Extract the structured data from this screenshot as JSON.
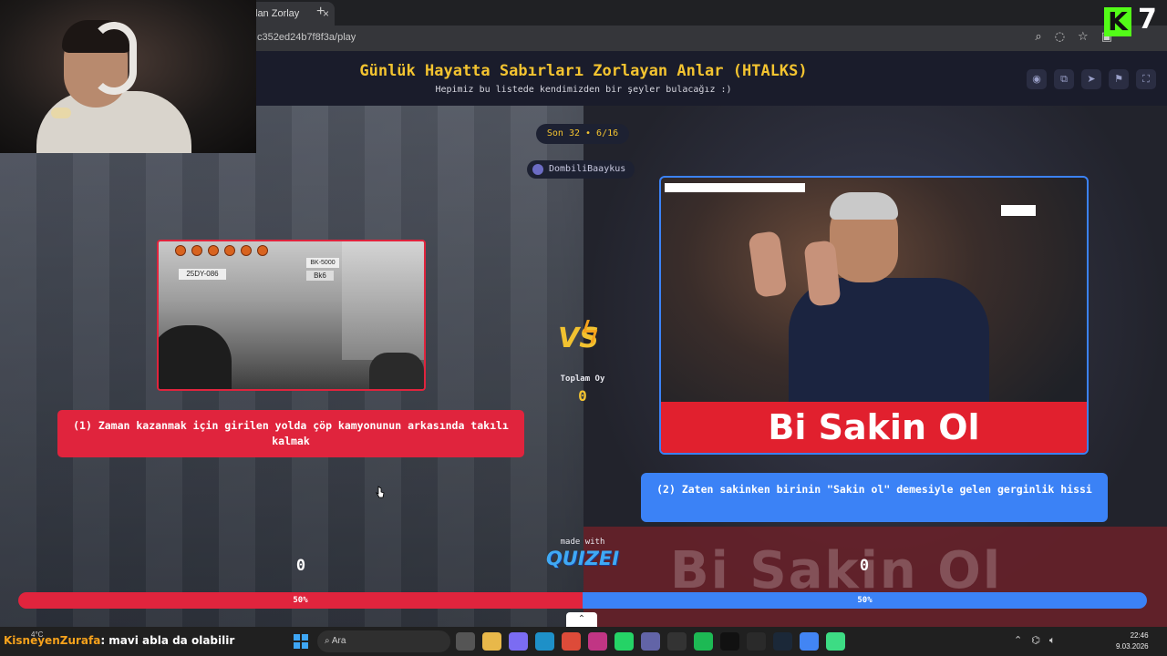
{
  "browser": {
    "tab_label": "lan Zorlay",
    "tab_close": "×",
    "new_tab": "+",
    "url": "c352ed24b7f8f3a/play",
    "icons": [
      "zoom-icon",
      "eye-off-icon",
      "star-icon",
      "extensions-icon",
      "profile-icon",
      "menu-icon"
    ]
  },
  "header": {
    "title": "Günlük Hayatta Sabırları Zorlayan Anlar (HTALKS)",
    "subtitle": "Hepimiz bu listede kendimizden bir şeyler bulacağız :)",
    "icons": [
      "eye-icon",
      "share-icon",
      "send-icon",
      "flag-icon",
      "fullscreen-icon"
    ]
  },
  "round": "Son 32 • 6/16",
  "creator": "DombiliBaaykus",
  "left_option": {
    "label": "(1) Zaman kazanmak için girilen yolda çöp kamyonunun arkasında takılı kalmak",
    "plates": [
      "25DY-086",
      "BK-5000",
      "Bk6"
    ],
    "score": "0",
    "percent": "50%",
    "color": "#e0243d"
  },
  "right_option": {
    "label": "(2) Zaten sakinken birinin \"Sakin ol\" demesiyle gelen gerginlik hissi",
    "image_caption": "Bi Sakin Ol",
    "score": "0",
    "percent": "50%",
    "color": "#3b82f6"
  },
  "vs": {
    "text": "VS",
    "total_label": "Toplam Oy",
    "total_value": "0"
  },
  "made_with": "made with",
  "brand": "QUIZEI",
  "progress": {
    "left_fraction": 0.5,
    "right_fraction": 0.5
  },
  "background_ghost_text": "Bi Sakin Ol",
  "overlay": {
    "logo_letter": "K",
    "logo_number": "7",
    "logo_color": "#53fc18"
  },
  "taskbar": {
    "chat_user": "KisneyenZurafa",
    "chat_message": ": mavi abla da olabilir",
    "weather": "4°C",
    "search_placeholder": "Ara",
    "time": "22:46",
    "date": "9.03.2026"
  }
}
